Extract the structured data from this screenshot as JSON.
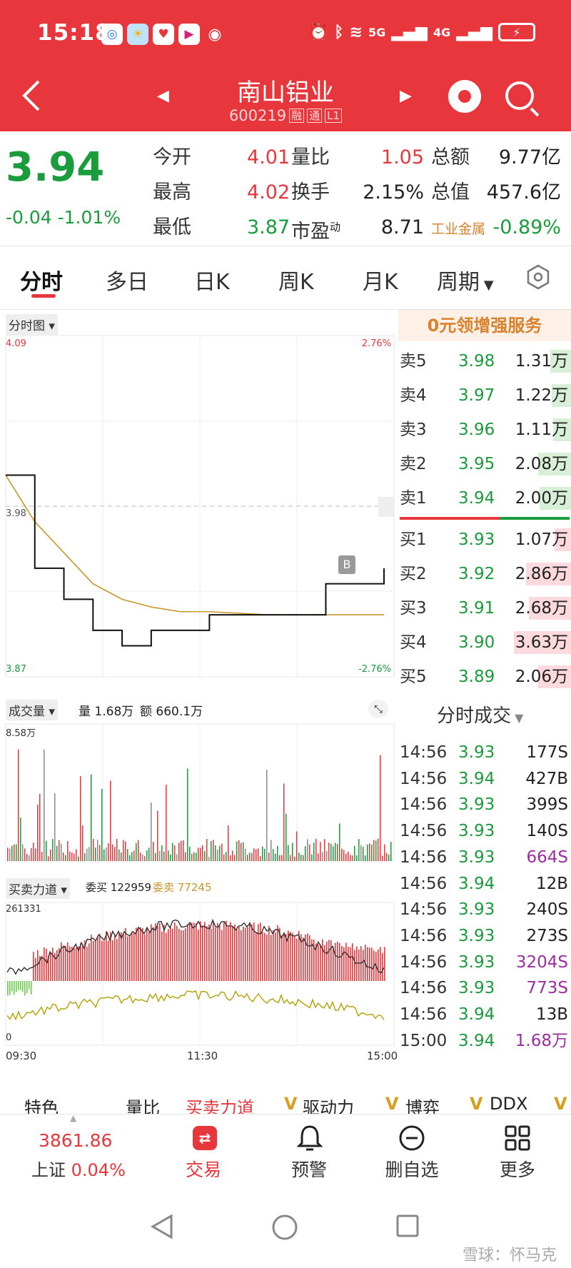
{
  "status": {
    "time": "15:18",
    "net1": "5G",
    "net2": "4G"
  },
  "header": {
    "name": "南山铝业",
    "code": "600219",
    "tags": [
      "融",
      "通",
      "L1"
    ]
  },
  "quote": {
    "price": "3.94",
    "change": "-0.04 -1.01%",
    "col1": [
      {
        "label": "今开",
        "value": "4.01"
      },
      {
        "label": "最高",
        "value": "4.02"
      },
      {
        "label": "最低",
        "value": "3.87"
      }
    ],
    "col2": [
      {
        "label": "量比",
        "value": "1.05"
      },
      {
        "label": "换手",
        "value": "2.15%"
      },
      {
        "label": "市盈",
        "sup": "动",
        "value": "8.71"
      }
    ],
    "col3": [
      {
        "label": "总额",
        "value": "9.77亿"
      },
      {
        "label": "总值",
        "value": "457.6亿"
      },
      {
        "label": "工业金属",
        "value": "-0.89%"
      }
    ]
  },
  "tabs": [
    "分时",
    "多日",
    "日K",
    "周K",
    "月K",
    "周期"
  ],
  "chart": {
    "intraday_label": "分时图",
    "price_top": "4.09",
    "price_mid": "3.98",
    "price_bottom": "3.87",
    "pct_top": "2.76%",
    "pct_bottom": "-2.76%",
    "marker": "B",
    "volume_label": "成交量",
    "volume_info": "量 1.68万",
    "amount_info": "额 660.1万",
    "volume_max": "8.58万",
    "force_label": "买卖力道",
    "bid_info": "委买 122959",
    "ask_info": "委卖 77245",
    "force_max": "261331",
    "force_min": "0",
    "time_start": "09:30",
    "time_mid": "11:30",
    "time_end": "15:00"
  },
  "chart_data": {
    "type": "line",
    "x_range": [
      "09:30",
      "15:00"
    ],
    "ylim": [
      3.87,
      4.09
    ],
    "prev_close": 3.98,
    "series": [
      {
        "values": [
          4.0,
          3.94,
          3.92,
          3.9,
          3.89,
          3.9,
          3.9,
          3.91,
          3.91,
          3.91,
          3.91,
          3.93,
          3.93,
          3.94
        ]
      },
      {
        "values": [
          4.0,
          3.97,
          3.95,
          3.93,
          3.92,
          3.915,
          3.912,
          3.912,
          3.911,
          3.91,
          3.91,
          3.91,
          3.91,
          3.91
        ]
      }
    ]
  },
  "book": {
    "promo": "0元领增强服务",
    "asks": [
      {
        "label": "卖5",
        "price": "3.98",
        "vol": "1.31万",
        "ratio": 0.36
      },
      {
        "label": "卖4",
        "price": "3.97",
        "vol": "1.22万",
        "ratio": 0.34
      },
      {
        "label": "卖3",
        "price": "3.96",
        "vol": "1.11万",
        "ratio": 0.31
      },
      {
        "label": "卖2",
        "price": "3.95",
        "vol": "2.08万",
        "ratio": 0.57
      },
      {
        "label": "卖1",
        "price": "3.94",
        "vol": "2.00万",
        "ratio": 0.55
      }
    ],
    "bids": [
      {
        "label": "买1",
        "price": "3.93",
        "vol": "1.07万",
        "ratio": 0.29
      },
      {
        "label": "买2",
        "price": "3.92",
        "vol": "2.86万",
        "ratio": 0.79
      },
      {
        "label": "买3",
        "price": "3.91",
        "vol": "2.68万",
        "ratio": 0.74
      },
      {
        "label": "买4",
        "price": "3.90",
        "vol": "3.63万",
        "ratio": 1.0
      },
      {
        "label": "买5",
        "price": "3.89",
        "vol": "2.06万",
        "ratio": 0.57
      }
    ]
  },
  "ticks_title": "分时成交",
  "ticks": [
    {
      "time": "14:56",
      "price": "3.93",
      "vol": "177S",
      "pc": "green",
      "vc": "dark"
    },
    {
      "time": "14:56",
      "price": "3.94",
      "vol": "427B",
      "pc": "green",
      "vc": "dark"
    },
    {
      "time": "14:56",
      "price": "3.93",
      "vol": "399S",
      "pc": "green",
      "vc": "dark"
    },
    {
      "time": "14:56",
      "price": "3.93",
      "vol": "140S",
      "pc": "green",
      "vc": "dark"
    },
    {
      "time": "14:56",
      "price": "3.93",
      "vol": "664S",
      "pc": "green",
      "vc": "purple"
    },
    {
      "time": "14:56",
      "price": "3.94",
      "vol": "12B",
      "pc": "green",
      "vc": "dark"
    },
    {
      "time": "14:56",
      "price": "3.93",
      "vol": "240S",
      "pc": "green",
      "vc": "dark"
    },
    {
      "time": "14:56",
      "price": "3.93",
      "vol": "273S",
      "pc": "green",
      "vc": "dark"
    },
    {
      "time": "14:56",
      "price": "3.93",
      "vol": "3204S",
      "pc": "green",
      "vc": "purple"
    },
    {
      "time": "14:56",
      "price": "3.93",
      "vol": "773S",
      "pc": "green",
      "vc": "purple"
    },
    {
      "time": "14:56",
      "price": "3.94",
      "vol": "13B",
      "pc": "green",
      "vc": "dark"
    },
    {
      "time": "15:00",
      "price": "3.94",
      "vol": "1.68万",
      "pc": "green",
      "vc": "purple"
    }
  ],
  "indicators": [
    "特色",
    "量比",
    "买卖力道",
    "V",
    "驱动力",
    "V",
    "博弈",
    "V",
    "DDX",
    "V"
  ],
  "bottom": {
    "index_value": "3861.86",
    "index_name": "上证",
    "index_change": "0.04%",
    "nav": [
      "交易",
      "预警",
      "删自选",
      "更多"
    ]
  },
  "watermark": "雪球：怀马克",
  "colors": {
    "red": "#e8373c",
    "green": "#1a9b3c",
    "gold": "#c9962a",
    "purple": "#9b2fa0"
  }
}
